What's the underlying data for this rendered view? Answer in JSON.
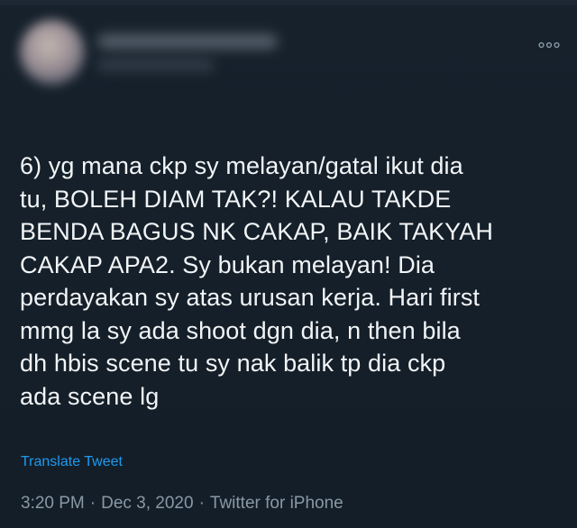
{
  "tweet": {
    "more_icon": "more-horizontal-icon",
    "text_lines": [
      "6) yg mana ckp sy melayan/gatal ikut dia",
      "tu, BOLEH DIAM TAK?! KALAU TAKDE",
      "BENDA BAGUS NK CAKAP, BAIK TAKYAH",
      "CAKAP APA2. Sy bukan melayan! Dia",
      "perdayakan sy atas urusan kerja. Hari first",
      "mmg la sy ada shoot dgn dia, n then bila",
      "dh hbis scene tu sy nak balik tp dia ckp",
      "ada scene lg"
    ],
    "translate_label": "Translate Tweet",
    "time": "3:20 PM",
    "separator": "·",
    "date": "Dec 3, 2020",
    "source": "Twitter for iPhone"
  },
  "colors": {
    "background": "#15202b",
    "text": "#f2f5f7",
    "link": "#1d9bf0",
    "muted": "#8899a6"
  }
}
